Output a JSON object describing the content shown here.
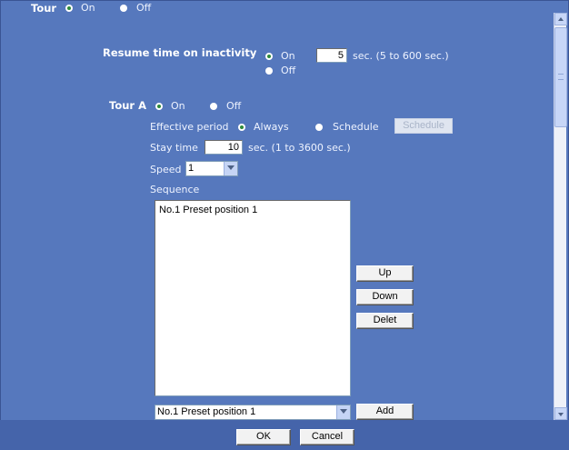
{
  "tour": {
    "label": "Tour",
    "on_label": "On",
    "off_label": "Off",
    "selected": "On"
  },
  "resume": {
    "label": "Resume time on inactivity",
    "on_label": "On",
    "off_label": "Off",
    "value": "5",
    "unit_text": "sec. (5 to 600 sec.)",
    "selected": "On"
  },
  "tour_a": {
    "label": "Tour A",
    "on_label": "On",
    "off_label": "Off",
    "selected": "On",
    "effective_period": {
      "label": "Effective period",
      "always_label": "Always",
      "schedule_label": "Schedule",
      "schedule_button": "Schedule",
      "selected": "Always"
    },
    "stay_time": {
      "label": "Stay time",
      "value": "10",
      "unit_text": "sec. (1 to 3600 sec.)"
    },
    "speed": {
      "label": "Speed",
      "value": "1"
    },
    "sequence": {
      "label": "Sequence",
      "items": [
        "No.1 Preset position 1"
      ],
      "up_button": "Up",
      "down_button": "Down",
      "delete_button": "Delet",
      "preset_select_value": "No.1 Preset position 1",
      "add_button": "Add"
    }
  },
  "footer": {
    "ok_button": "OK",
    "cancel_button": "Cancel"
  },
  "colors": {
    "panel": "#5678bd",
    "footer": "#4564aa",
    "radio_selected_dot": "#2e8a3a"
  }
}
